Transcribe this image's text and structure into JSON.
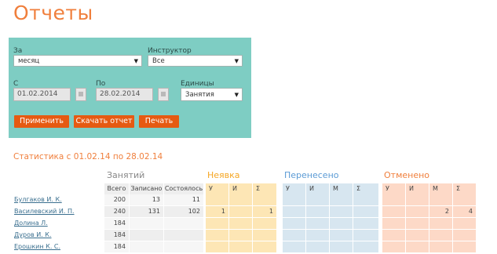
{
  "page": {
    "title": "Отчеты"
  },
  "filters": {
    "period_label": "За",
    "period_value": "месяц",
    "instructor_label": "Инструктор",
    "instructor_value": "Все",
    "from_label": "С",
    "from_value": "01.02.2014",
    "to_label": "По",
    "to_value": "28.02.2014",
    "units_label": "Единицы",
    "units_value": "Занятия"
  },
  "buttons": {
    "apply": "Применить",
    "download": "Скачать отчет",
    "print": "Печать"
  },
  "stats_title": "Статистика с 01.02.14 по 28.02.14",
  "groups": {
    "sessions": {
      "title": "Занятий",
      "cols": [
        "Всего",
        "Записано",
        "Состоялось"
      ]
    },
    "noshow": {
      "title": "Неявка",
      "cols": [
        "У",
        "И",
        "Σ"
      ],
      "color": "#f5a623"
    },
    "moved": {
      "title": "Перенесено",
      "cols": [
        "У",
        "И",
        "М",
        "Σ"
      ],
      "color": "#5b9bd5"
    },
    "cancelled": {
      "title": "Отменено",
      "cols": [
        "У",
        "И",
        "М",
        "Σ"
      ],
      "color": "#f07f3c"
    }
  },
  "rows": [
    {
      "name": "Булгаков И. К.",
      "total": "200",
      "enrolled": "13",
      "held": "11",
      "noshow": [
        "",
        "",
        ""
      ],
      "moved": [
        "",
        "",
        "",
        ""
      ],
      "cancelled": [
        "",
        "",
        "",
        ""
      ]
    },
    {
      "name": "Василевский И. П.",
      "total": "240",
      "enrolled": "131",
      "held": "102",
      "noshow": [
        "1",
        "",
        "1"
      ],
      "moved": [
        "",
        "",
        "",
        ""
      ],
      "cancelled": [
        "",
        "",
        "2",
        "4"
      ]
    },
    {
      "name": "Долина Л.",
      "total": "184",
      "enrolled": "",
      "held": "",
      "noshow": [
        "",
        "",
        ""
      ],
      "moved": [
        "",
        "",
        "",
        ""
      ],
      "cancelled": [
        "",
        "",
        "",
        ""
      ]
    },
    {
      "name": "Дуров И. К.",
      "total": "184",
      "enrolled": "",
      "held": "",
      "noshow": [
        "",
        "",
        ""
      ],
      "moved": [
        "",
        "",
        "",
        ""
      ],
      "cancelled": [
        "",
        "",
        "",
        ""
      ]
    },
    {
      "name": "Ерошкин К. С.",
      "total": "184",
      "enrolled": "",
      "held": "",
      "noshow": [
        "",
        "",
        ""
      ],
      "moved": [
        "",
        "",
        "",
        ""
      ],
      "cancelled": [
        "",
        "",
        "",
        ""
      ]
    }
  ]
}
